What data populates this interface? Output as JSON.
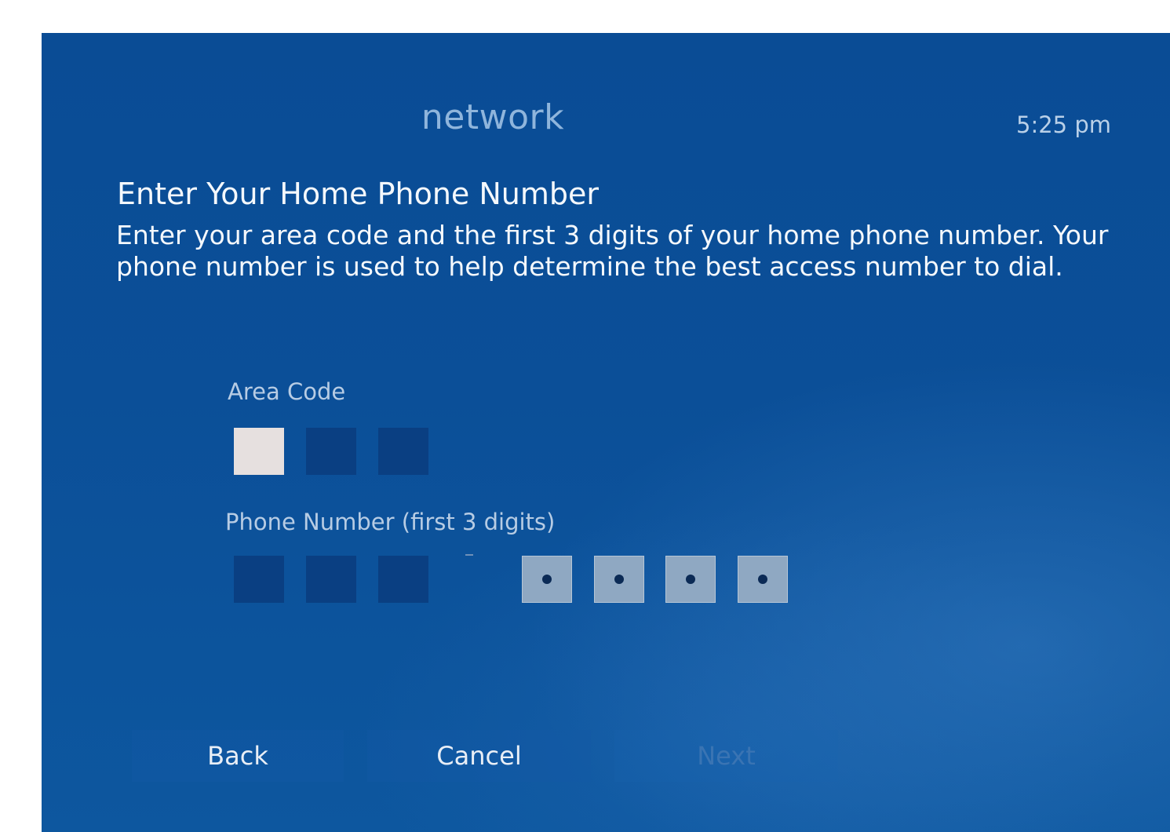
{
  "header": {
    "title": "network",
    "clock": "5:25 pm"
  },
  "heading": "Enter Your Home Phone Number",
  "description": "Enter your area code and the first 3 digits of your home phone number. Your phone number is used to help determine the best access number to dial.",
  "area_code": {
    "label": "Area Code"
  },
  "phone_number": {
    "label": "Phone Number (first 3 digits)",
    "separator": "-"
  },
  "buttons": {
    "back": "Back",
    "cancel": "Cancel",
    "next": "Next"
  }
}
